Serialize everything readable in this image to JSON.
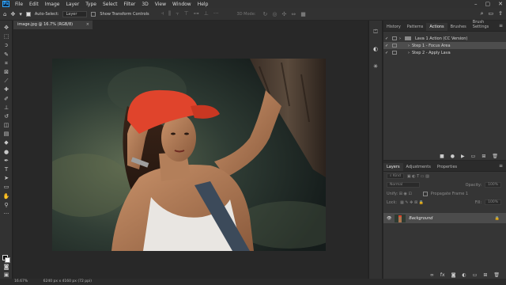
{
  "app": {
    "logo": "Ps"
  },
  "menu": [
    "File",
    "Edit",
    "Image",
    "Layer",
    "Type",
    "Select",
    "Filter",
    "3D",
    "View",
    "Window",
    "Help"
  ],
  "options_bar": {
    "auto_select_label": "Auto-Select:",
    "auto_select_value": "Layer",
    "transform_controls_label": "Show Transform Controls",
    "mode_3d_label": "3D Mode:"
  },
  "document": {
    "tab_title": "image.jpg @ 16.7% (RGB/8)",
    "tab_close": "×"
  },
  "status": {
    "zoom": "16.67%",
    "info": "6240 px x 4160 px (72 ppi)"
  },
  "actions_panel": {
    "tabs": [
      "History",
      "Patterns",
      "Actions",
      "Brushes",
      "Brush Settings"
    ],
    "active_tab": "Actions",
    "items": [
      {
        "label": "Lava 1 Action (CC Version)",
        "type": "set"
      },
      {
        "label": "Step 1 - Focus Area",
        "type": "step",
        "selected": true
      },
      {
        "label": "Step 2 - Apply Lava",
        "type": "step"
      }
    ]
  },
  "layers_panel": {
    "tabs": [
      "Layers",
      "Adjustments",
      "Properties"
    ],
    "active_tab": "Layers",
    "filter_kind": "Kind",
    "blend_mode": "Normal",
    "opacity_label": "Opacity:",
    "opacity_value": "100%",
    "lock_label": "Lock:",
    "fill_label": "Fill:",
    "fill_value": "100%",
    "propagate_label": "Propagate Frame 1",
    "layers": [
      {
        "name": "Background",
        "locked": true,
        "visible": true
      }
    ]
  },
  "colors": {
    "accent": "#31a8ff",
    "panel": "#353535",
    "canvas": "#282828"
  }
}
